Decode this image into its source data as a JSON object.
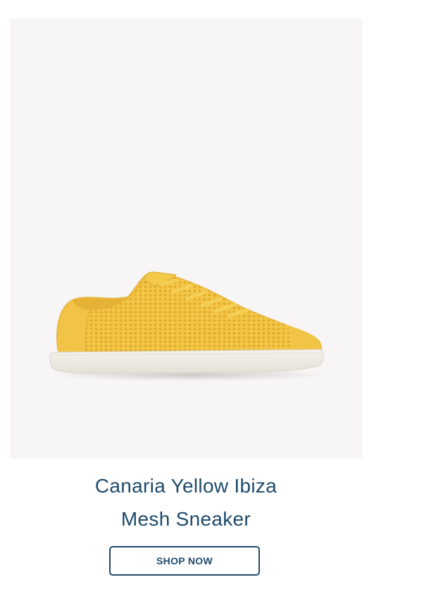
{
  "product": {
    "name_line1": "Canaria Yellow Ibiza",
    "name_line2": "Mesh Sneaker",
    "image_alt": "Canaria Yellow Ibiza Mesh Sneaker",
    "image_background": "#f7f5f5",
    "shoe_color": "#f3c94a",
    "sole_color": "#f2efe8"
  },
  "cta": {
    "label": "SHOP NOW"
  },
  "theme": {
    "text_color": "#1d4a6b"
  }
}
